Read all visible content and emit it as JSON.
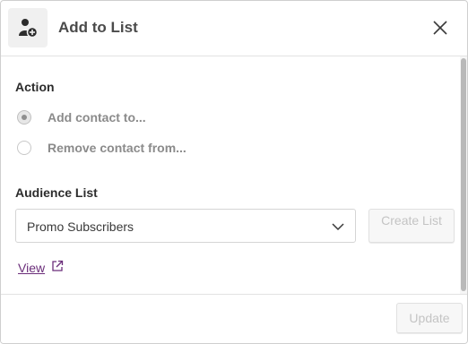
{
  "header": {
    "title": "Add to List",
    "icon": "add-user-icon",
    "close_icon": "close-icon"
  },
  "action": {
    "label": "Action",
    "options": [
      {
        "label": "Add contact to...",
        "checked": true
      },
      {
        "label": "Remove contact from...",
        "checked": false
      }
    ]
  },
  "audience": {
    "label": "Audience List",
    "selected": "Promo Subscribers",
    "create_label": "Create List",
    "view_label": "View"
  },
  "footer": {
    "update_label": "Update"
  },
  "colors": {
    "link": "#6b2e7a",
    "disabled_text": "#c4c4c4"
  }
}
